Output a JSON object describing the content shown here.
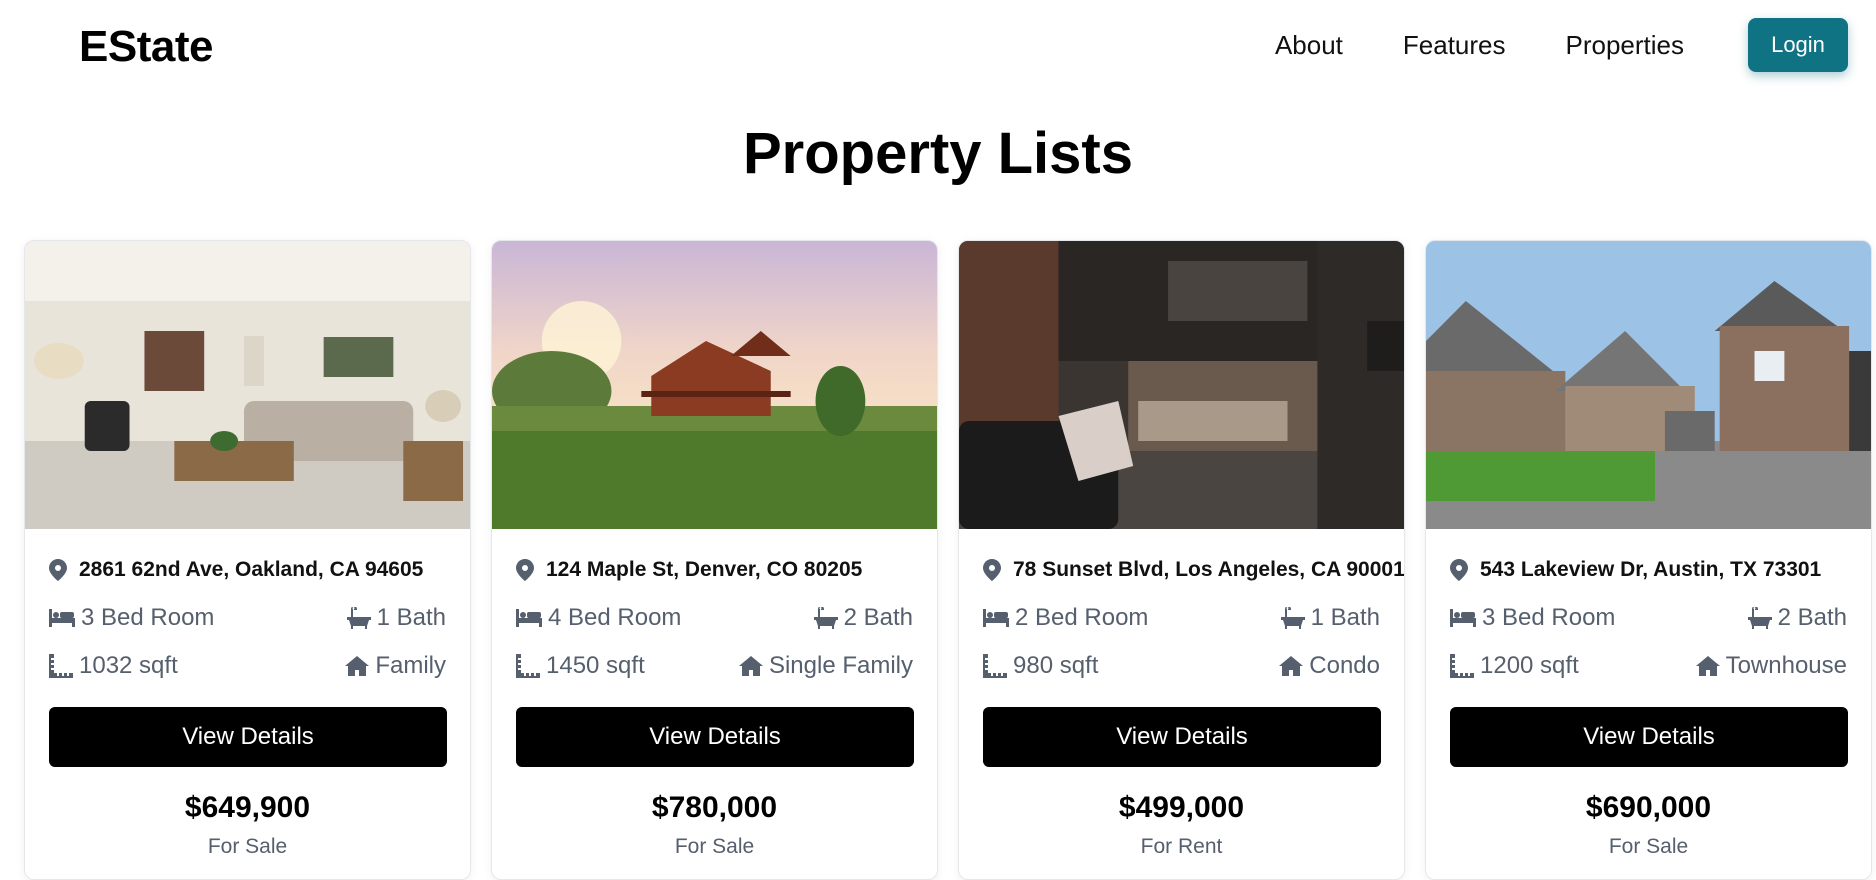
{
  "brand": "EState",
  "nav": {
    "about": "About",
    "features": "Features",
    "properties": "Properties",
    "login": "Login"
  },
  "page_title": "Property Lists",
  "colors": {
    "accent": "#0f7384",
    "button": "#000000",
    "muted": "#555f6d"
  },
  "properties": [
    {
      "address": "2861 62nd Ave, Oakland, CA 94605",
      "beds": "3 Bed Room",
      "baths": "1 Bath",
      "area": "1032 sqft",
      "type": "Family",
      "cta": "View Details",
      "price": "$649,900",
      "status": "For Sale",
      "image": "living-room-photo"
    },
    {
      "address": "124 Maple St, Denver, CO 80205",
      "beds": "4 Bed Room",
      "baths": "2 Bath",
      "area": "1450 sqft",
      "type": "Single Family",
      "cta": "View Details",
      "price": "$780,000",
      "status": "For Sale",
      "image": "lodge-house-sunset-photo"
    },
    {
      "address": "78 Sunset Blvd, Los Angeles, CA 90001",
      "beds": "2 Bed Room",
      "baths": "1 Bath",
      "area": "980 sqft",
      "type": "Condo",
      "cta": "View Details",
      "price": "$499,000",
      "status": "For Rent",
      "image": "loft-interior-photo"
    },
    {
      "address": "543 Lakeview Dr, Austin, TX 73301",
      "beds": "3 Bed Room",
      "baths": "2 Bath",
      "area": "1200 sqft",
      "type": "Townhouse",
      "cta": "View Details",
      "price": "$690,000",
      "status": "For Sale",
      "image": "townhouse-street-photo"
    }
  ]
}
